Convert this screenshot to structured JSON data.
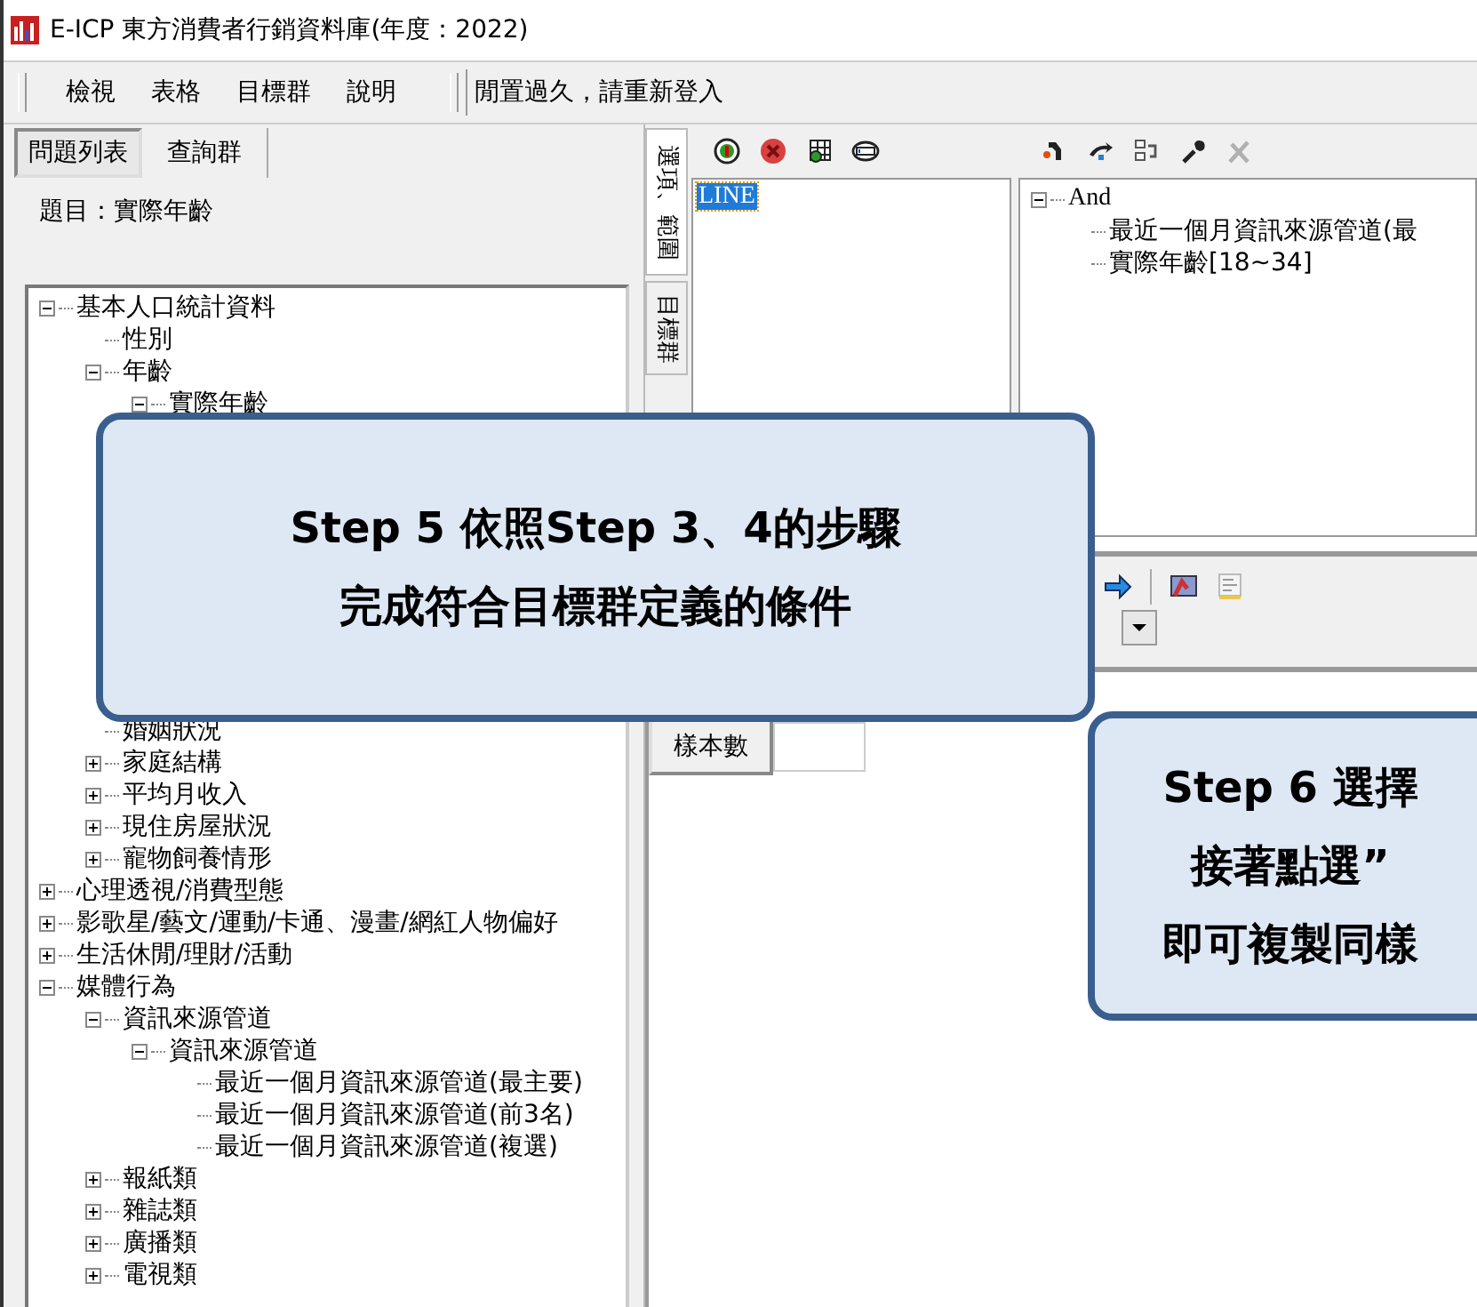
{
  "window": {
    "title": "E-ICP 東方消費者行銷資料庫(年度：2022)"
  },
  "menu": [
    {
      "label": "檢視"
    },
    {
      "label": "表格"
    },
    {
      "label": "目標群"
    },
    {
      "label": "說明"
    }
  ],
  "status_message": "閒置過久，請重新登入",
  "left_tabs": [
    {
      "label": "問題列表",
      "selected": true
    },
    {
      "label": "查詢群",
      "selected": false
    }
  ],
  "question_title": "題目：實際年齡",
  "tree": [
    {
      "label": "基本人口統計資料",
      "expanded": true,
      "children": [
        {
          "label": "性別"
        },
        {
          "label": "年齡",
          "expanded": true,
          "children": [
            {
              "label": "實際年齡",
              "expanded": true
            }
          ]
        },
        {
          "label": "婚姻狀況"
        },
        {
          "label": "家庭結構",
          "expanded": false
        },
        {
          "label": "平均月收入",
          "expanded": false
        },
        {
          "label": "現住房屋狀況",
          "expanded": false
        },
        {
          "label": "寵物飼養情形",
          "expanded": false
        }
      ]
    },
    {
      "label": "心理透視/消費型態",
      "expanded": false
    },
    {
      "label": "影歌星/藝文/運動/卡通、漫畫/網紅人物偏好",
      "expanded": false
    },
    {
      "label": "生活休閒/理財/活動",
      "expanded": false
    },
    {
      "label": "媒體行為",
      "expanded": true,
      "children": [
        {
          "label": "資訊來源管道",
          "expanded": true,
          "children": [
            {
              "label": "資訊來源管道",
              "expanded": true,
              "children": [
                {
                  "label": "最近一個月資訊來源管道(最主要)"
                },
                {
                  "label": "最近一個月資訊來源管道(前3名)"
                },
                {
                  "label": "最近一個月資訊來源管道(複選)"
                }
              ]
            }
          ]
        },
        {
          "label": "報紙類",
          "expanded": false
        },
        {
          "label": "雜誌類",
          "expanded": false
        },
        {
          "label": "廣播類",
          "expanded": false
        },
        {
          "label": "電視類",
          "expanded": false
        }
      ]
    }
  ],
  "vertical_tabs": [
    {
      "label": "選項、範圍",
      "selected": true
    },
    {
      "label": "目標群",
      "selected": false
    }
  ],
  "options_list": [
    {
      "label": "LINE",
      "selected": true
    }
  ],
  "condition_tree": {
    "label": "And",
    "expanded": true,
    "children": [
      {
        "label": "最近一個月資訊來源管道(最"
      },
      {
        "label": "實際年齡[18~34]"
      }
    ]
  },
  "sample_button": "樣本數",
  "callouts": [
    {
      "lines": [
        "Step 5 依照Step 3、4的步驟",
        "完成符合目標群定義的條件"
      ]
    },
    {
      "lines": [
        "Step 6 選擇",
        "接著點選”",
        "即可複製同樣"
      ]
    }
  ]
}
